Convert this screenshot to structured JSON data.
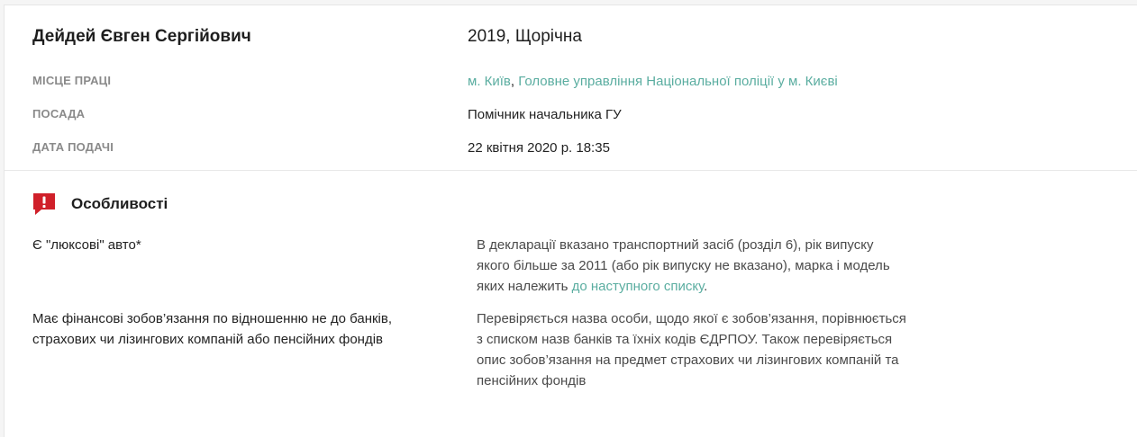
{
  "header": {
    "person_name": "Дейдей Євген Сергійович",
    "declaration": "2019, Щорічна"
  },
  "info": {
    "workplace_label": "МІСЦЕ ПРАЦІ",
    "workplace_city": "м. Київ",
    "workplace_separator": ", ",
    "workplace_org": "Головне управління Національної поліції у м. Києві",
    "position_label": "ПОСАДА",
    "position_value": "Помічник начальника ГУ",
    "date_label": "ДАТА ПОДАЧІ",
    "date_value": "22 квітня 2020 р. 18:35"
  },
  "features": {
    "title": "Особливості",
    "icon": "alert-icon",
    "items": [
      {
        "name": "Є \"люксові\" авто*",
        "desc_before": "В декларації вказано транспортний засіб (розділ 6), рік випуску якого більше за 2011 (або рік випуску не вказано), марка і модель яких належить ",
        "desc_link": "до наступного списку",
        "desc_after": "."
      },
      {
        "name": "Має фінансові зобов’язання по відношенню не до банків, страхових чи лізингових компаній або пенсійних фондів",
        "desc_before": "Перевіряється назва особи, щодо якої є зобов’язання, порівнюється з списком назв банків та їхніх кодів ЄДРПОУ. Також перевіряється опис зобов’язання на предмет страхових чи лізингових компаній та пенсійних фондів",
        "desc_link": "",
        "desc_after": ""
      }
    ]
  },
  "colors": {
    "accent_link": "#5aada0",
    "alert_red": "#d0202a"
  }
}
